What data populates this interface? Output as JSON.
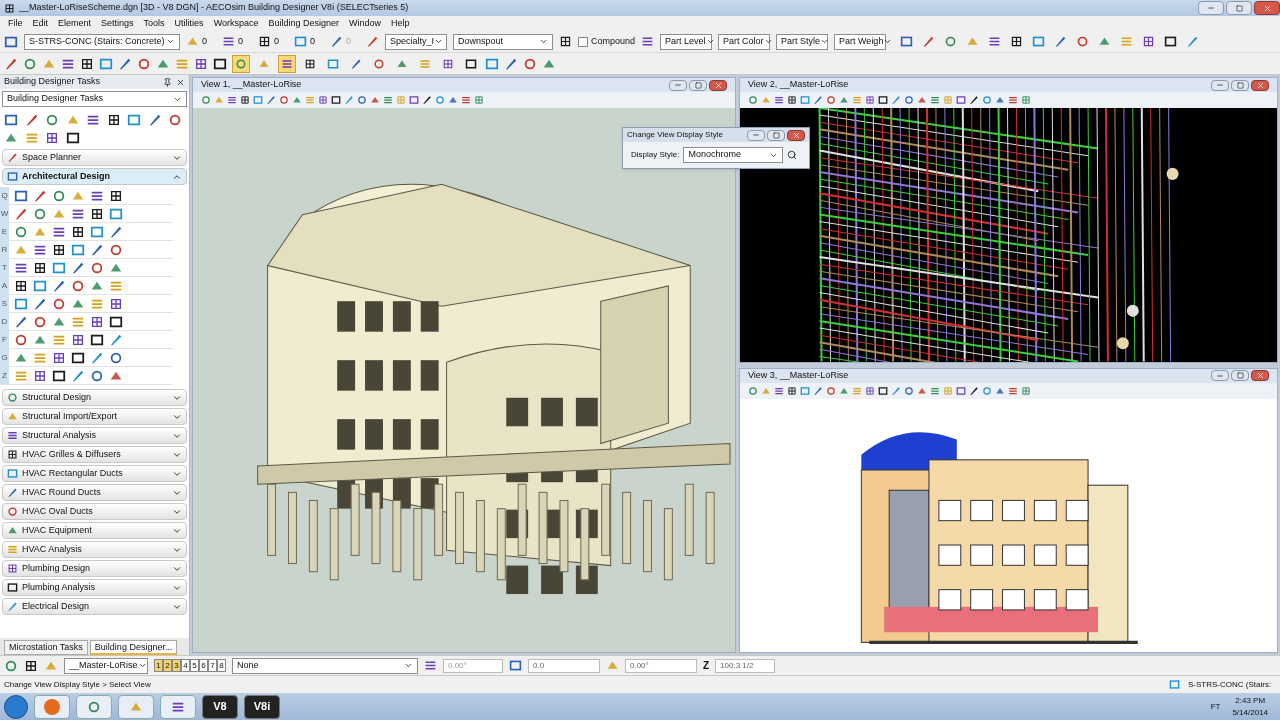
{
  "window": {
    "title": "__Master-LoRiseScheme.dgn [3D - V8 DGN] - AECOsim Building Designer V8i (SELECTseries 5)"
  },
  "menu": [
    "File",
    "Edit",
    "Element",
    "Settings",
    "Tools",
    "Utilities",
    "Workspace",
    "Building Designer",
    "Window",
    "Help"
  ],
  "attributes": {
    "level": "S-STRS-CONC (Stairs: Concrete)",
    "counts": [
      {
        "value": "0",
        "disabled": false
      },
      {
        "value": "0",
        "disabled": false
      },
      {
        "value": "0",
        "disabled": false
      },
      {
        "value": "0",
        "disabled": false
      },
      {
        "value": "0",
        "disabled": true
      }
    ],
    "specialty": "Specialty_I",
    "part": "Downspout",
    "compound": {
      "label": "Compound",
      "checked": false
    },
    "part_filters": [
      "Part Level",
      "Part Color",
      "Part Style",
      "Part Weigh"
    ]
  },
  "snap_modes": [
    {
      "selected": true
    },
    {
      "selected": false
    },
    {
      "selected": true
    },
    {
      "selected": false
    },
    {
      "selected": false
    },
    {
      "selected": false
    },
    {
      "selected": false
    },
    {
      "selected": false
    },
    {
      "selected": false
    },
    {
      "selected": false
    },
    {
      "selected": false
    }
  ],
  "tasks": {
    "title": "Building Designer Tasks",
    "dropdown": "Building Designer Tasks",
    "sections_before": [
      {
        "label": "Space Planner",
        "expanded": false
      }
    ],
    "active": {
      "label": "Architectural Design",
      "expanded": true,
      "rows": [
        "Q",
        "W",
        "E",
        "R",
        "T",
        "A",
        "S",
        "D",
        "F",
        "G",
        "Z"
      ]
    },
    "sections_after": [
      {
        "label": "Structural Design",
        "expanded": false
      },
      {
        "label": "Structural Import/Export",
        "expanded": false
      },
      {
        "label": "Structural Analysis",
        "expanded": false
      },
      {
        "label": "HVAC Grilles & Diffusers",
        "expanded": false
      },
      {
        "label": "HVAC Rectangular Ducts",
        "expanded": false
      },
      {
        "label": "HVAC Round Ducts",
        "expanded": false
      },
      {
        "label": "HVAC Oval Ducts",
        "expanded": false
      },
      {
        "label": "HVAC Equipment",
        "expanded": false
      },
      {
        "label": "HVAC Analysis",
        "expanded": false
      },
      {
        "label": "Plumbing Design",
        "expanded": false
      },
      {
        "label": "Plumbing Analysis",
        "expanded": false
      },
      {
        "label": "Electrical Design",
        "expanded": false
      }
    ],
    "tabs": [
      {
        "label": "Microstation Tasks",
        "selected": false
      },
      {
        "label": "Building Designer...",
        "selected": true
      }
    ]
  },
  "views": [
    {
      "title": "View 1, __Master-LoRise",
      "kind": "model"
    },
    {
      "title": "View 2, __Master-LoRise",
      "kind": "plan"
    },
    {
      "title": "View 3, __Master-LoRise",
      "kind": "elevation"
    }
  ],
  "dialog": {
    "title": "Change View Display Style",
    "label": "Display Style:",
    "value": "Monochrome"
  },
  "view_bar": {
    "model": "__Master-LoRise",
    "view_buttons": [
      {
        "label": "1",
        "selected": true
      },
      {
        "label": "2",
        "selected": true
      },
      {
        "label": "3",
        "selected": true
      },
      {
        "label": "4",
        "selected": false
      },
      {
        "label": "5",
        "selected": false
      },
      {
        "label": "6",
        "selected": false
      },
      {
        "label": "7",
        "selected": false
      },
      {
        "label": "8",
        "selected": false
      }
    ],
    "named_view": "None",
    "angle": "0.00°",
    "distance": "0.0",
    "rotation": "0.00°",
    "z_label": "Z",
    "z_value": "100:3 1/2"
  },
  "status": {
    "prompt": "Change View Display Style > Select View",
    "level": "S-STRS-CONC (Stairs: "
  },
  "taskbar": {
    "apps": [
      "V8",
      "V8i"
    ],
    "tray": "FT",
    "time": "2:43 PM",
    "date": "5/14/2014"
  }
}
